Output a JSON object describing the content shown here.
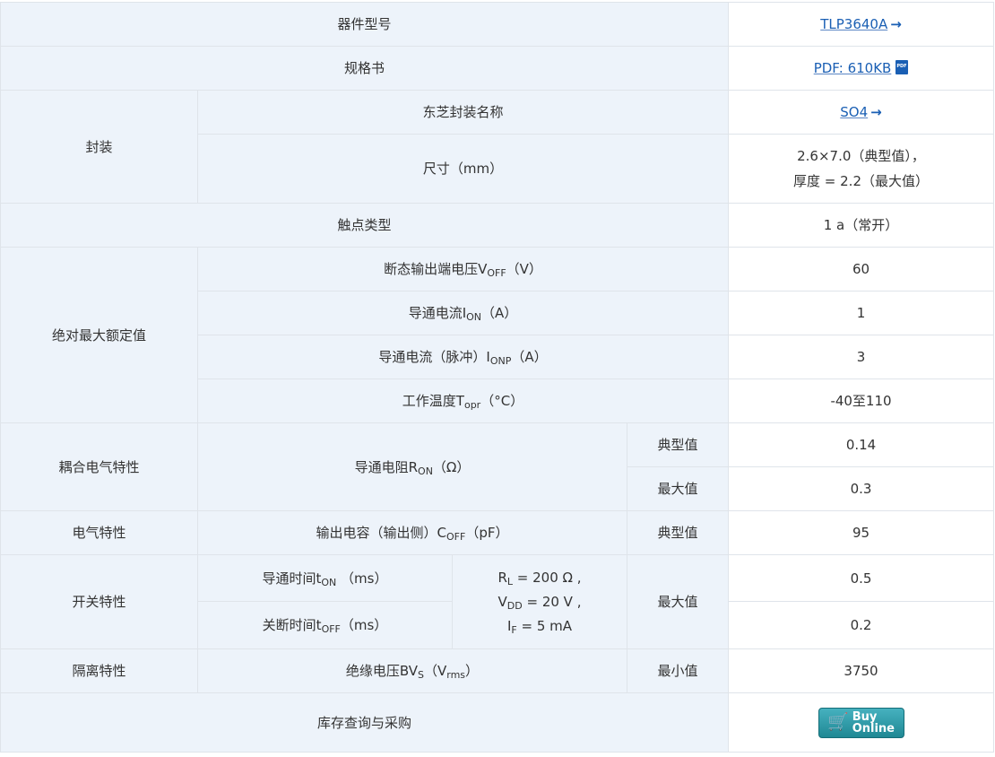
{
  "rows": {
    "part_number": {
      "label": "器件型号",
      "value": "TLP3640A"
    },
    "datasheet": {
      "label": "规格书",
      "value": "PDF: 610KB"
    },
    "package": {
      "label": "封装",
      "toshiba_name_label": "东芝封装名称",
      "toshiba_name_value": "SO4",
      "size_label": "尺寸（mm）",
      "size_line1": "2.6×7.0（典型值），",
      "size_line2": "厚度 = 2.2（最大值）"
    },
    "contact_type": {
      "label": "触点类型",
      "value": "1 a（常开）"
    },
    "abs_max": {
      "label": "绝对最大额定值",
      "voff_pre": "断态输出端电压V",
      "voff_sub": "OFF",
      "voff_post": "（V）",
      "voff_value": "60",
      "ion_pre": "导通电流I",
      "ion_sub": "ON",
      "ion_post": "（A）",
      "ion_value": "1",
      "ionp_pre": "导通电流（脉冲）I",
      "ionp_sub": "ONP",
      "ionp_post": "（A）",
      "ionp_value": "3",
      "topr_pre": "工作温度T",
      "topr_sub": "opr",
      "topr_post": "（°C）",
      "topr_value": "-40至110"
    },
    "coupled": {
      "label": "耦合电气特性",
      "ron_pre": "导通电阻R",
      "ron_sub": "ON",
      "ron_post": "（Ω）",
      "typ_label": "典型值",
      "typ_value": "0.14",
      "max_label": "最大值",
      "max_value": "0.3"
    },
    "electrical": {
      "label": "电气特性",
      "coff_pre": "输出电容（输出侧）C",
      "coff_sub": "OFF",
      "coff_post": "（pF）",
      "cond": "典型值",
      "value": "95"
    },
    "switching": {
      "label": "开关特性",
      "ton_pre": "导通时间t",
      "ton_sub": "ON",
      "ton_post": " （ms）",
      "toff_pre": "关断时间t",
      "toff_sub": "OFF",
      "toff_post": "（ms）",
      "rl_pre": "R",
      "rl_sub": "L",
      "rl_post": " = 200 Ω ,",
      "vdd_pre": "V",
      "vdd_sub": "DD",
      "vdd_post": " = 20 V ,",
      "if_pre": "I",
      "if_sub": "F",
      "if_post": " = 5 mA",
      "cond": "最大值",
      "ton_value": "0.5",
      "toff_value": "0.2"
    },
    "isolation": {
      "label": "隔离特性",
      "bvs_pre": "绝缘电压BV",
      "bvs_sub": "S",
      "bvs_mid": "（V",
      "vrms_sub": "rms",
      "bvs_post": "）",
      "cond": "最小值",
      "value": "3750"
    },
    "purchase": {
      "label": "库存查询与采购",
      "button_line1": "Buy",
      "button_line2": "Online"
    }
  },
  "icons": {
    "arrow": "arrow-right-icon",
    "pdf": "pdf-icon",
    "cart": "shopping-cart-icon"
  },
  "colors": {
    "label_bg": "#edf3fa",
    "link": "#1a5fb4",
    "button": "#2a9aa6",
    "border": "#dfe4ea"
  }
}
